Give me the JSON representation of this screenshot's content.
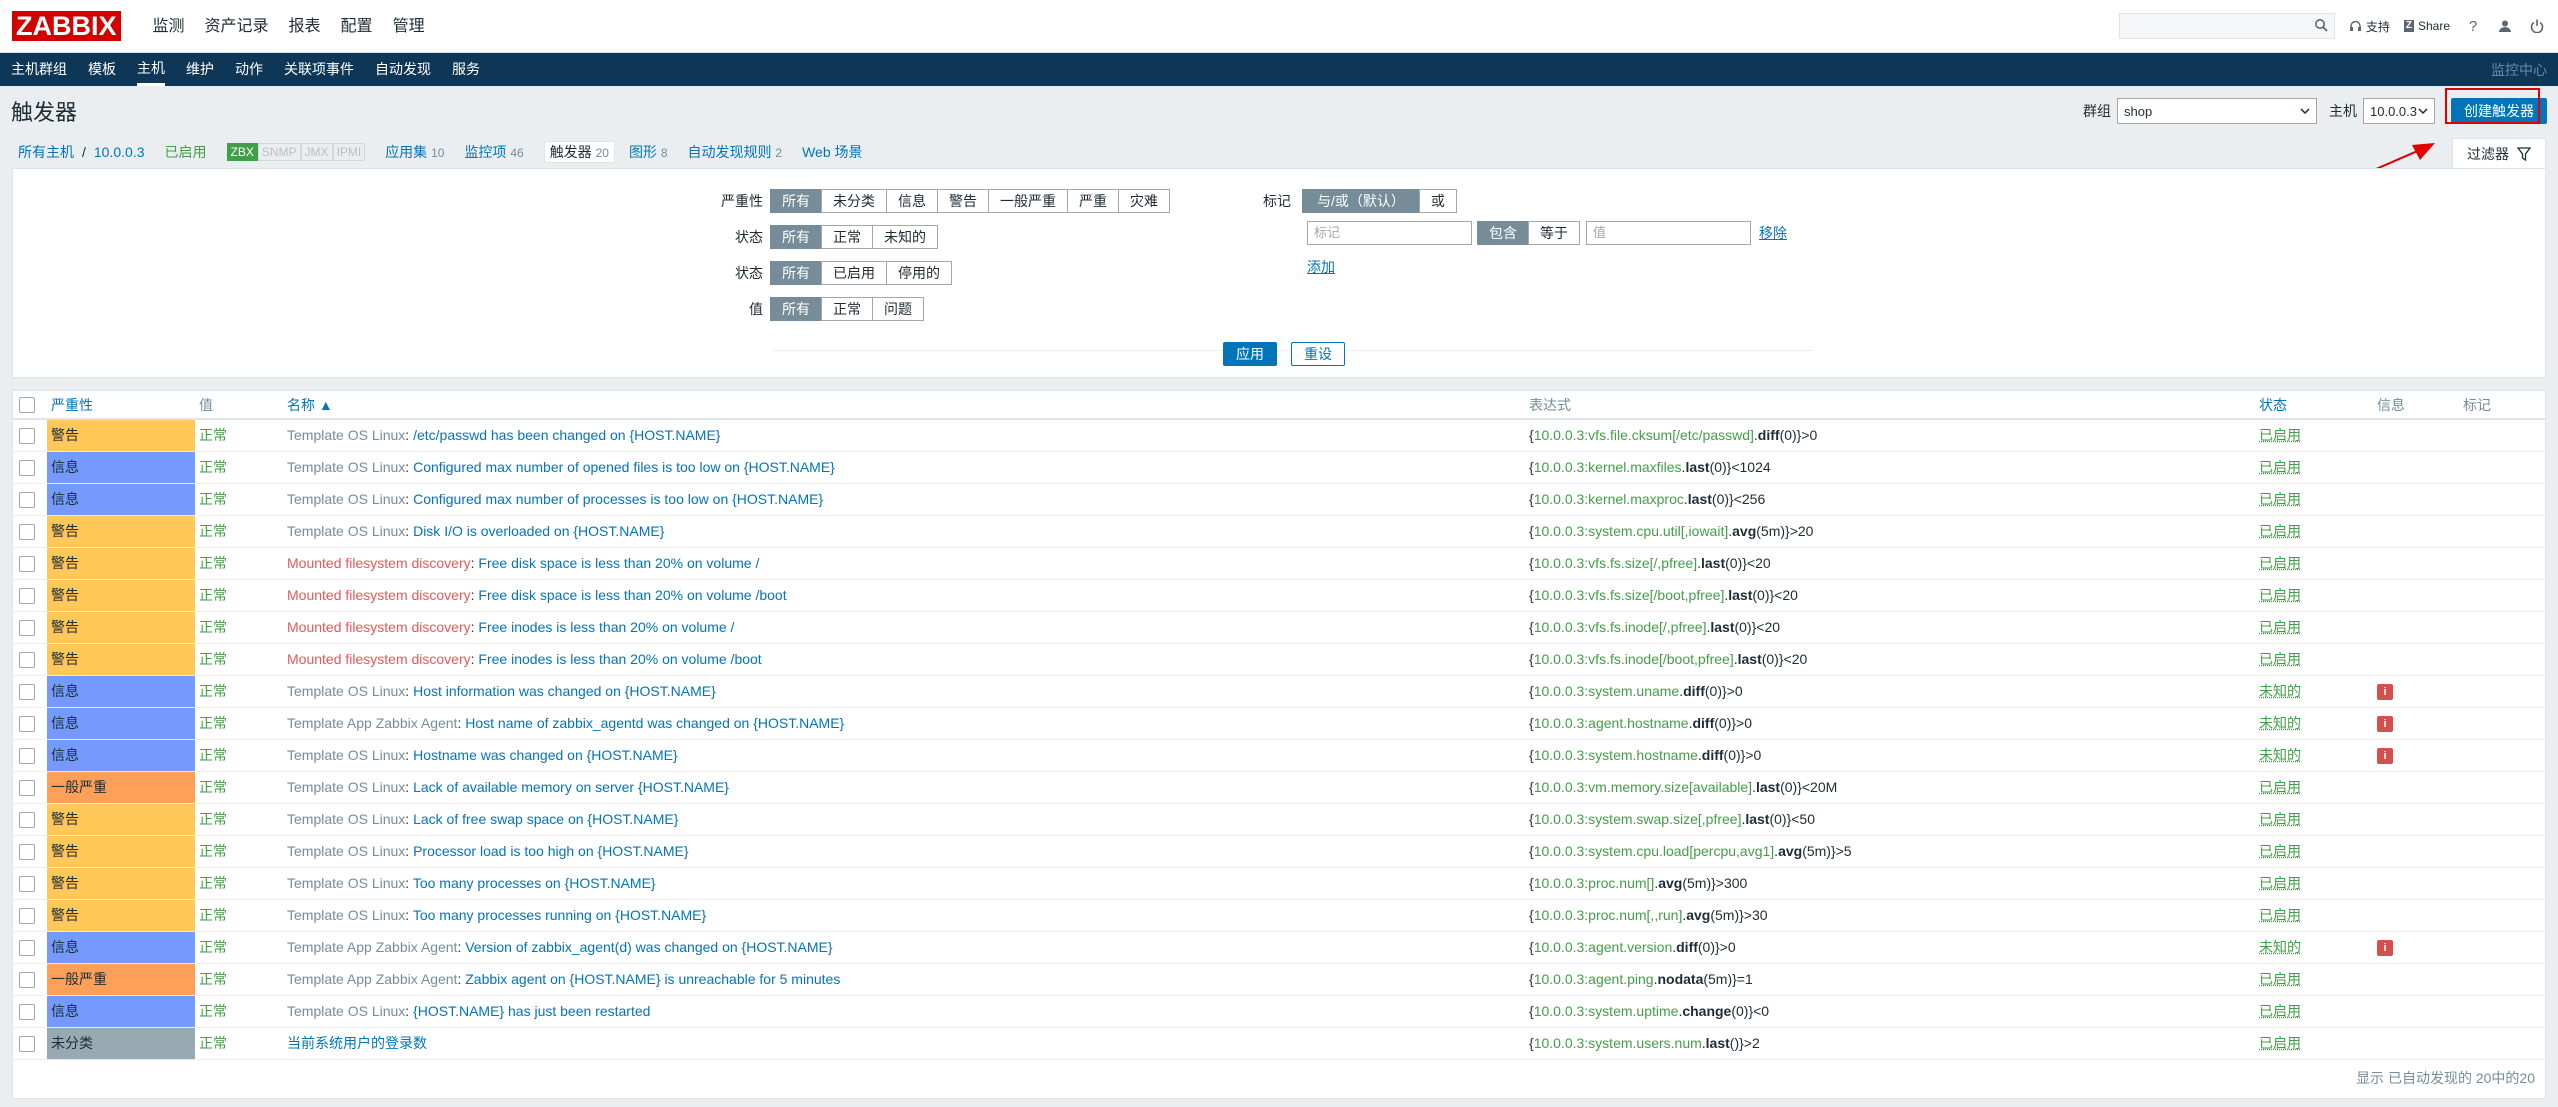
{
  "app": {
    "logo": "ZABBIX"
  },
  "main_menu": [
    "监测",
    "资产记录",
    "报表",
    "配置",
    "管理"
  ],
  "top_right": {
    "support": "支持",
    "share": "Share",
    "help": "?"
  },
  "sub_menu": {
    "items": [
      "主机群组",
      "模板",
      "主机",
      "维护",
      "动作",
      "关联项事件",
      "自动发现",
      "服务"
    ],
    "active": "主机",
    "right": "监控中心"
  },
  "header": {
    "title": "触发器",
    "group_label": "群组",
    "group_value": "shop",
    "host_label": "主机",
    "host_value": "10.0.0.3",
    "create_button": "创建触发器"
  },
  "host_nav": {
    "all_hosts": "所有主机",
    "separator": "/",
    "host": "10.0.0.3",
    "enabled": "已启用",
    "availability": [
      "ZBX",
      "SNMP",
      "JMX",
      "IPMI"
    ],
    "apps": {
      "label": "应用集",
      "count": "10"
    },
    "items": {
      "label": "监控项",
      "count": "46"
    },
    "triggers": {
      "label": "触发器",
      "count": "20"
    },
    "graphs": {
      "label": "图形",
      "count": "8"
    },
    "discovery": {
      "label": "自动发现规则",
      "count": "2"
    },
    "web": {
      "label": "Web 场景"
    },
    "filter_tab": "过滤器"
  },
  "filter": {
    "severity": {
      "label": "严重性",
      "options": [
        "所有",
        "未分类",
        "信息",
        "警告",
        "一般严重",
        "严重",
        "灾难"
      ]
    },
    "state": {
      "label": "状态",
      "options": [
        "所有",
        "正常",
        "未知的"
      ]
    },
    "status": {
      "label": "状态",
      "options": [
        "所有",
        "已启用",
        "停用的"
      ]
    },
    "value": {
      "label": "值",
      "options": [
        "所有",
        "正常",
        "问题"
      ]
    },
    "tags": {
      "label": "标记",
      "mode": [
        "与/或（默认）",
        "或"
      ],
      "tag_placeholder": "标记",
      "operator": [
        "包含",
        "等于"
      ],
      "value_placeholder": "值",
      "remove": "移除",
      "add": "添加"
    },
    "apply": "应用",
    "reset": "重设"
  },
  "table": {
    "headers": {
      "severity": "严重性",
      "value": "值",
      "name": "名称 ▲",
      "expression": "表达式",
      "status": "状态",
      "info": "信息",
      "tags": "标记"
    },
    "rows": [
      {
        "sev": "警告",
        "sevColor": "#ffc859",
        "val": "正常",
        "tmpl": "Template OS Linux",
        "tmplType": "tmpl",
        "name": "/etc/passwd has been changed on {HOST.NAME}",
        "exHost": "10.0.0.3:vfs.file.cksum[/etc/passwd]",
        "exFn": "diff",
        "exArg": "(0)}>0",
        "status": "已启用",
        "info": false
      },
      {
        "sev": "信息",
        "sevColor": "#7499ff",
        "val": "正常",
        "tmpl": "Template OS Linux",
        "tmplType": "tmpl",
        "name": "Configured max number of opened files is too low on {HOST.NAME}",
        "exHost": "10.0.0.3:kernel.maxfiles",
        "exFn": "last",
        "exArg": "(0)}<1024",
        "status": "已启用",
        "info": false
      },
      {
        "sev": "信息",
        "sevColor": "#7499ff",
        "val": "正常",
        "tmpl": "Template OS Linux",
        "tmplType": "tmpl",
        "name": "Configured max number of processes is too low on {HOST.NAME}",
        "exHost": "10.0.0.3:kernel.maxproc",
        "exFn": "last",
        "exArg": "(0)}<256",
        "status": "已启用",
        "info": false
      },
      {
        "sev": "警告",
        "sevColor": "#ffc859",
        "val": "正常",
        "tmpl": "Template OS Linux",
        "tmplType": "tmpl",
        "name": "Disk I/O is overloaded on {HOST.NAME}",
        "exHost": "10.0.0.3:system.cpu.util[,iowait]",
        "exFn": "avg",
        "exArg": "(5m)}>20",
        "status": "已启用",
        "info": false
      },
      {
        "sev": "警告",
        "sevColor": "#ffc859",
        "val": "正常",
        "tmpl": "Mounted filesystem discovery",
        "tmplType": "disc",
        "name": "Free disk space is less than 20% on volume /",
        "exHost": "10.0.0.3:vfs.fs.size[/,pfree]",
        "exFn": "last",
        "exArg": "(0)}<20",
        "status": "已启用",
        "info": false
      },
      {
        "sev": "警告",
        "sevColor": "#ffc859",
        "val": "正常",
        "tmpl": "Mounted filesystem discovery",
        "tmplType": "disc",
        "name": "Free disk space is less than 20% on volume /boot",
        "exHost": "10.0.0.3:vfs.fs.size[/boot,pfree]",
        "exFn": "last",
        "exArg": "(0)}<20",
        "status": "已启用",
        "info": false
      },
      {
        "sev": "警告",
        "sevColor": "#ffc859",
        "val": "正常",
        "tmpl": "Mounted filesystem discovery",
        "tmplType": "disc",
        "name": "Free inodes is less than 20% on volume /",
        "exHost": "10.0.0.3:vfs.fs.inode[/,pfree]",
        "exFn": "last",
        "exArg": "(0)}<20",
        "status": "已启用",
        "info": false
      },
      {
        "sev": "警告",
        "sevColor": "#ffc859",
        "val": "正常",
        "tmpl": "Mounted filesystem discovery",
        "tmplType": "disc",
        "name": "Free inodes is less than 20% on volume /boot",
        "exHost": "10.0.0.3:vfs.fs.inode[/boot,pfree]",
        "exFn": "last",
        "exArg": "(0)}<20",
        "status": "已启用",
        "info": false
      },
      {
        "sev": "信息",
        "sevColor": "#7499ff",
        "val": "正常",
        "tmpl": "Template OS Linux",
        "tmplType": "tmpl",
        "name": "Host information was changed on {HOST.NAME}",
        "exHost": "10.0.0.3:system.uname",
        "exFn": "diff",
        "exArg": "(0)}>0",
        "status": "未知的",
        "info": true
      },
      {
        "sev": "信息",
        "sevColor": "#7499ff",
        "val": "正常",
        "tmpl": "Template App Zabbix Agent",
        "tmplType": "tmpl",
        "name": "Host name of zabbix_agentd was changed on {HOST.NAME}",
        "exHost": "10.0.0.3:agent.hostname",
        "exFn": "diff",
        "exArg": "(0)}>0",
        "status": "未知的",
        "info": true
      },
      {
        "sev": "信息",
        "sevColor": "#7499ff",
        "val": "正常",
        "tmpl": "Template OS Linux",
        "tmplType": "tmpl",
        "name": "Hostname was changed on {HOST.NAME}",
        "exHost": "10.0.0.3:system.hostname",
        "exFn": "diff",
        "exArg": "(0)}>0",
        "status": "未知的",
        "info": true
      },
      {
        "sev": "一般严重",
        "sevColor": "#ffa059",
        "val": "正常",
        "tmpl": "Template OS Linux",
        "tmplType": "tmpl",
        "name": "Lack of available memory on server {HOST.NAME}",
        "exHost": "10.0.0.3:vm.memory.size[available]",
        "exFn": "last",
        "exArg": "(0)}<20M",
        "status": "已启用",
        "info": false
      },
      {
        "sev": "警告",
        "sevColor": "#ffc859",
        "val": "正常",
        "tmpl": "Template OS Linux",
        "tmplType": "tmpl",
        "name": "Lack of free swap space on {HOST.NAME}",
        "exHost": "10.0.0.3:system.swap.size[,pfree]",
        "exFn": "last",
        "exArg": "(0)}<50",
        "status": "已启用",
        "info": false
      },
      {
        "sev": "警告",
        "sevColor": "#ffc859",
        "val": "正常",
        "tmpl": "Template OS Linux",
        "tmplType": "tmpl",
        "name": "Processor load is too high on {HOST.NAME}",
        "exHost": "10.0.0.3:system.cpu.load[percpu,avg1]",
        "exFn": "avg",
        "exArg": "(5m)}>5",
        "status": "已启用",
        "info": false
      },
      {
        "sev": "警告",
        "sevColor": "#ffc859",
        "val": "正常",
        "tmpl": "Template OS Linux",
        "tmplType": "tmpl",
        "name": "Too many processes on {HOST.NAME}",
        "exHost": "10.0.0.3:proc.num[]",
        "exFn": "avg",
        "exArg": "(5m)}>300",
        "status": "已启用",
        "info": false
      },
      {
        "sev": "警告",
        "sevColor": "#ffc859",
        "val": "正常",
        "tmpl": "Template OS Linux",
        "tmplType": "tmpl",
        "name": "Too many processes running on {HOST.NAME}",
        "exHost": "10.0.0.3:proc.num[,,run]",
        "exFn": "avg",
        "exArg": "(5m)}>30",
        "status": "已启用",
        "info": false
      },
      {
        "sev": "信息",
        "sevColor": "#7499ff",
        "val": "正常",
        "tmpl": "Template App Zabbix Agent",
        "tmplType": "tmpl",
        "name": "Version of zabbix_agent(d) was changed on {HOST.NAME}",
        "exHost": "10.0.0.3:agent.version",
        "exFn": "diff",
        "exArg": "(0)}>0",
        "status": "未知的",
        "info": true
      },
      {
        "sev": "一般严重",
        "sevColor": "#ffa059",
        "val": "正常",
        "tmpl": "Template App Zabbix Agent",
        "tmplType": "tmpl",
        "name": "Zabbix agent on {HOST.NAME} is unreachable for 5 minutes",
        "exHost": "10.0.0.3:agent.ping",
        "exFn": "nodata",
        "exArg": "(5m)}=1",
        "status": "已启用",
        "info": false
      },
      {
        "sev": "信息",
        "sevColor": "#7499ff",
        "val": "正常",
        "tmpl": "Template OS Linux",
        "tmplType": "tmpl",
        "name": "{HOST.NAME} has just been restarted",
        "exHost": "10.0.0.3:system.uptime",
        "exFn": "change",
        "exArg": "(0)}<0",
        "status": "已启用",
        "info": false
      },
      {
        "sev": "未分类",
        "sevColor": "#97aab3",
        "val": "正常",
        "tmpl": "",
        "tmplType": "none",
        "name": "当前系统用户的登录数",
        "exHost": "10.0.0.3:system.users.num",
        "exFn": "last",
        "exArg": "()}>2",
        "status": "已启用",
        "info": false
      }
    ],
    "footer": "显示 已自动发现的 20中的20"
  }
}
